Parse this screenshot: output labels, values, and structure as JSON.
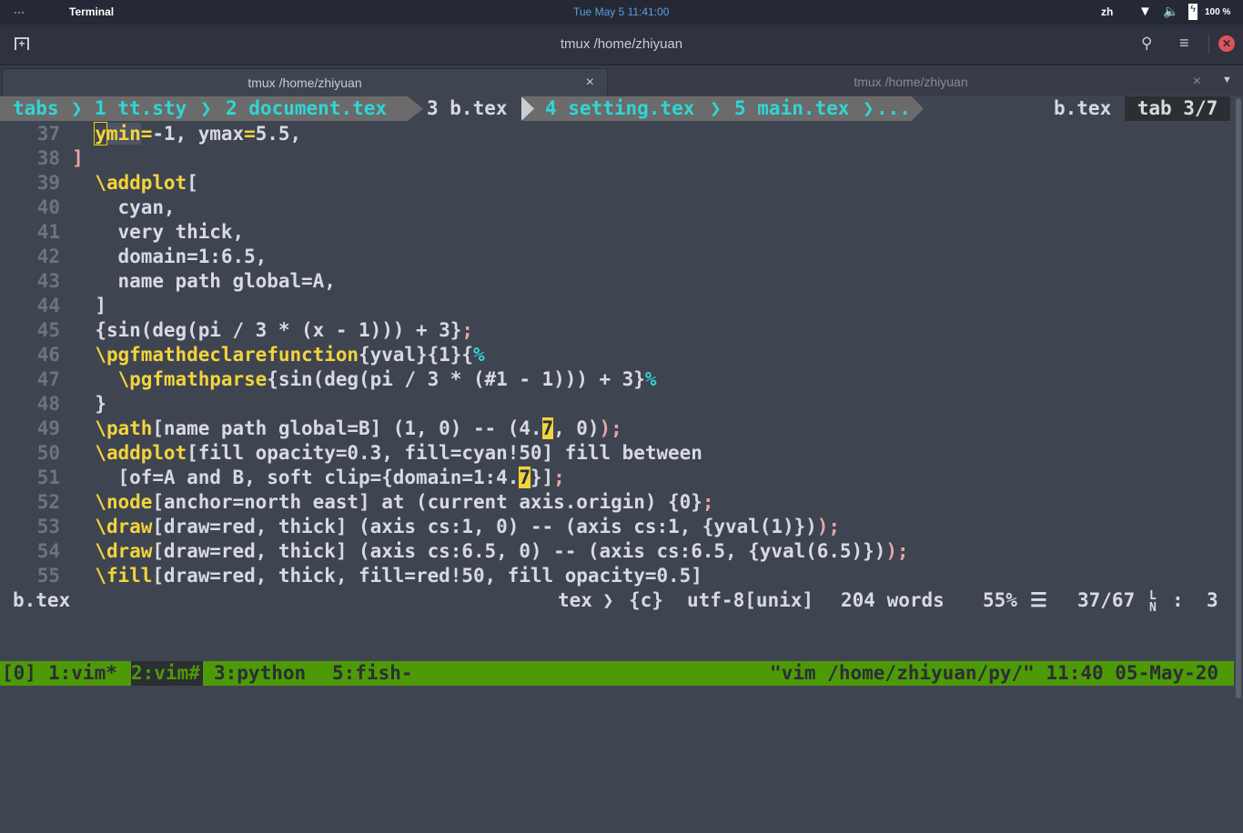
{
  "system_bar": {
    "menu": "···",
    "app": "Terminal",
    "clock": "Tue May 5  11:41:00",
    "lang": "zh",
    "battery": "100 %"
  },
  "window": {
    "title": "tmux /home/zhiyuan"
  },
  "tabs": [
    {
      "label": "tmux /home/zhiyuan",
      "close": "×",
      "active": true
    },
    {
      "label": "tmux /home/zhiyuan",
      "close": "×",
      "active": false
    }
  ],
  "vim_tabline": {
    "items": [
      "tabs",
      "1 tt.sty",
      "2 document.tex",
      "3 b.tex",
      "4 setting.tex",
      "5 main.tex",
      "..."
    ],
    "current_file": "b.tex",
    "tab_counter": "tab 3/7"
  },
  "code": [
    {
      "num": "37",
      "segs": [
        [
          "    ",
          "n"
        ],
        [
          "y",
          "cur"
        ],
        [
          "min",
          "hl"
        ],
        [
          "=",
          "k"
        ],
        [
          "-1, ymax",
          "n"
        ],
        [
          "=",
          "k"
        ],
        [
          "5.5,",
          "n"
        ]
      ]
    },
    {
      "num": "38",
      "segs": [
        [
          "  ]",
          "p"
        ]
      ]
    },
    {
      "num": "39",
      "segs": [
        [
          "    ",
          "n"
        ],
        [
          "\\addplot",
          "k"
        ],
        [
          "[",
          "n"
        ]
      ]
    },
    {
      "num": "40",
      "segs": [
        [
          "      cyan,",
          "n"
        ]
      ]
    },
    {
      "num": "41",
      "segs": [
        [
          "      very thick,",
          "n"
        ]
      ]
    },
    {
      "num": "42",
      "segs": [
        [
          "      domain=1:6.5,",
          "n"
        ]
      ]
    },
    {
      "num": "43",
      "segs": [
        [
          "      name path global=A,",
          "n"
        ]
      ]
    },
    {
      "num": "44",
      "segs": [
        [
          "    ]",
          "n"
        ]
      ]
    },
    {
      "num": "45",
      "segs": [
        [
          "    {sin(deg(pi / 3 * (x - 1))) + 3}",
          "n"
        ],
        [
          ";",
          "p"
        ]
      ]
    },
    {
      "num": "46",
      "segs": [
        [
          "    ",
          "n"
        ],
        [
          "\\pgfmathdeclarefunction",
          "k"
        ],
        [
          "{yval}{1}{",
          "n"
        ],
        [
          "%",
          "c"
        ]
      ]
    },
    {
      "num": "47",
      "segs": [
        [
          "      ",
          "n"
        ],
        [
          "\\pgfmathparse",
          "k"
        ],
        [
          "{sin(deg(pi / 3 * (#1 - 1))) + 3}",
          "n"
        ],
        [
          "%",
          "c"
        ]
      ]
    },
    {
      "num": "48",
      "segs": [
        [
          "    }",
          "n"
        ]
      ]
    },
    {
      "num": "49",
      "segs": [
        [
          "    ",
          "n"
        ],
        [
          "\\path",
          "k"
        ],
        [
          "[name path global=B] (1, 0) -- (4.",
          "n"
        ],
        [
          "7",
          "s"
        ],
        [
          ", 0)",
          "n"
        ],
        [
          ");",
          "p"
        ]
      ]
    },
    {
      "num": "50",
      "segs": [
        [
          "    ",
          "n"
        ],
        [
          "\\addplot",
          "k"
        ],
        [
          "[fill opacity=0.3, fill=cyan!50] fill between",
          "n"
        ]
      ]
    },
    {
      "num": "51",
      "segs": [
        [
          "      [of=A and B, soft clip={domain=1:4.",
          "n"
        ],
        [
          "7",
          "s"
        ],
        [
          "}]",
          "n"
        ],
        [
          ";",
          "p"
        ]
      ]
    },
    {
      "num": "52",
      "segs": [
        [
          "    ",
          "n"
        ],
        [
          "\\node",
          "k"
        ],
        [
          "[anchor=north east] at (current axis.origin) {0}",
          "n"
        ],
        [
          ";",
          "p"
        ]
      ]
    },
    {
      "num": "53",
      "segs": [
        [
          "    ",
          "n"
        ],
        [
          "\\draw",
          "k"
        ],
        [
          "[draw=red, thick] (axis cs:1, 0) -- (axis cs:1, {yval(1)})",
          "n"
        ],
        [
          ");",
          "p"
        ]
      ]
    },
    {
      "num": "54",
      "segs": [
        [
          "    ",
          "n"
        ],
        [
          "\\draw",
          "k"
        ],
        [
          "[draw=red, thick] (axis cs:6.5, 0) -- (axis cs:6.5, {yval(6.5)})",
          "n"
        ],
        [
          ");",
          "p"
        ]
      ]
    },
    {
      "num": "55",
      "segs": [
        [
          "    ",
          "n"
        ],
        [
          "\\fill",
          "k"
        ],
        [
          "[draw=red, thick, fill=red!50, fill opacity=0.5]",
          "n"
        ]
      ]
    }
  ],
  "statusline": {
    "file": "b.tex",
    "filetype": "tex",
    "scope": "{c}",
    "encoding": "utf-8[unix]",
    "words": "204 words",
    "percent": "55%",
    "position": "37/67",
    "column": "3"
  },
  "tmux": {
    "session": "[0]",
    "windows": [
      "1:vim*",
      "2:vim#",
      "3:python",
      "5:fish-"
    ],
    "right": "\"vim /home/zhiyuan/py/\" 11:40 05-May-20"
  },
  "colors": {
    "background": "#3f4451",
    "keyword": "#f2d43c",
    "accent_cyan": "#30d5d5",
    "tmux_bar": "#4e9a06"
  }
}
